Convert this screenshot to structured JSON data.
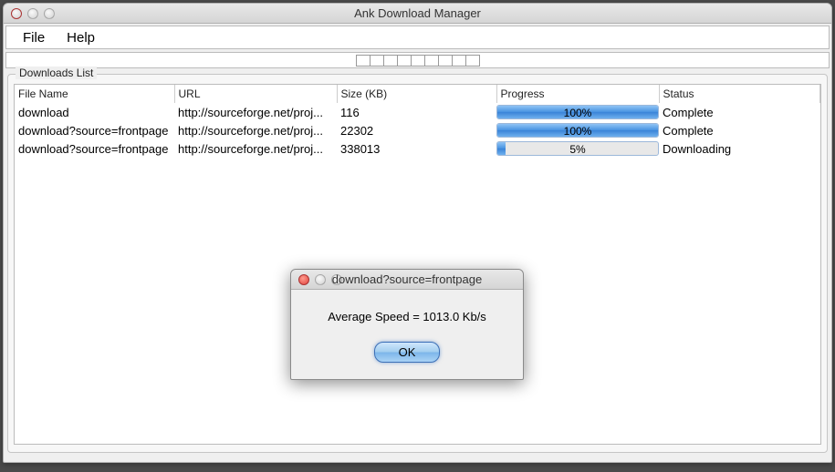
{
  "window": {
    "title": "Ank Download Manager"
  },
  "menu": {
    "file": "File",
    "help": "Help"
  },
  "group": {
    "label": "Downloads List"
  },
  "columns": {
    "fileName": "File Name",
    "url": "URL",
    "size": "Size (KB)",
    "progress": "Progress",
    "status": "Status"
  },
  "rows": [
    {
      "fileName": "download",
      "url": "http://sourceforge.net/proj...",
      "size": "116",
      "progress": 100,
      "progressLabel": "100%",
      "status": "Complete"
    },
    {
      "fileName": "download?source=frontpage",
      "url": "http://sourceforge.net/proj...",
      "size": "22302",
      "progress": 100,
      "progressLabel": "100%",
      "status": "Complete"
    },
    {
      "fileName": "download?source=frontpage",
      "url": "http://sourceforge.net/proj...",
      "size": "338013",
      "progress": 5,
      "progressLabel": "5%",
      "status": "Downloading"
    }
  ],
  "dialog": {
    "title": "download?source=frontpage",
    "message": "Average Speed = 1013.0 Kb/s",
    "ok": "OK"
  }
}
